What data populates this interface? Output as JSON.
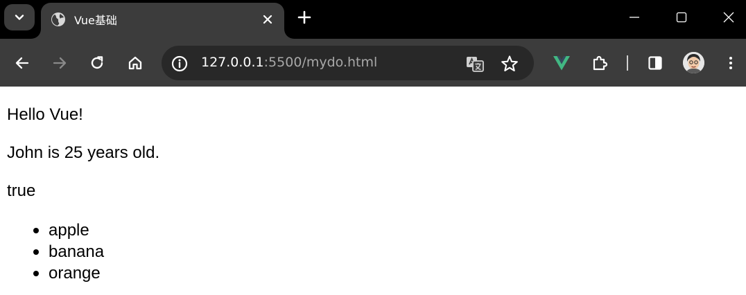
{
  "browser": {
    "tab": {
      "title": "Vue基础"
    },
    "address_bar": {
      "host": "127.0.0.1",
      "rest": ":5500/mydo.html"
    }
  },
  "page": {
    "message": "Hello Vue!",
    "person_line": "John is 25 years old.",
    "flag": "true",
    "fruits": [
      "apple",
      "banana",
      "orange"
    ]
  },
  "colors": {
    "titlebar_bg": "#000000",
    "toolbar_bg": "#3c3c3c",
    "omnibox_bg": "#282828",
    "vue_green": "#42b883"
  }
}
